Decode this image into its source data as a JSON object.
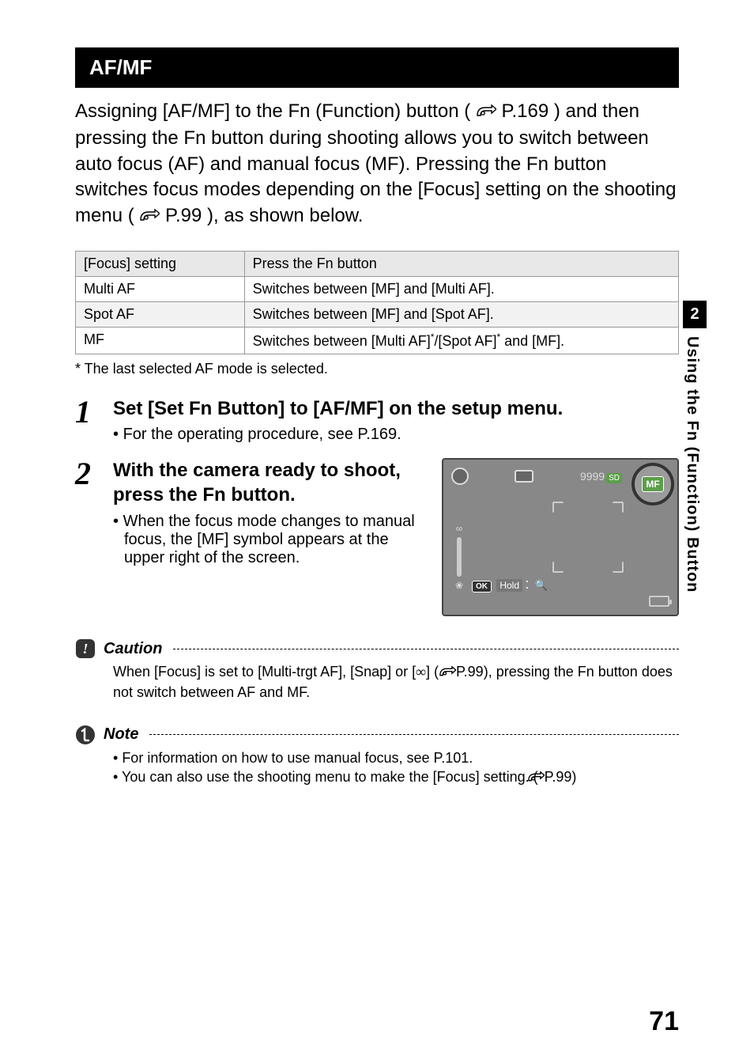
{
  "title_bar": "AF/MF",
  "intro": {
    "part1": "Assigning [AF/MF] to the Fn (Function) button (",
    "ref1": "P.169",
    "part2": ") and then pressing the Fn button during shooting allows you to switch between auto focus (AF) and manual focus (MF). Pressing the Fn button switches focus modes depending on the [Focus] setting on the shooting menu (",
    "ref2": "P.99",
    "part3": "), as shown below."
  },
  "table": {
    "h1": "[Focus] setting",
    "h2": "Press the Fn button",
    "rows": [
      {
        "c1": "Multi AF",
        "c2": "Switches between [MF] and [Multi AF]."
      },
      {
        "c1": "Spot AF",
        "c2": "Switches between [MF] and [Spot AF]."
      },
      {
        "c1": "MF",
        "c2_a": "Switches between [Multi AF]",
        "c2_b": "/[Spot AF]",
        "c2_c": " and [MF]."
      }
    ]
  },
  "footnote": "*    The last selected AF mode is selected.",
  "steps": {
    "s1_num": "1",
    "s1_title": "Set [Set Fn Button] to [AF/MF] on the setup menu.",
    "s1_sub": "For the operating procedure, see P.169.",
    "s2_num": "2",
    "s2_title": "With the camera ready to shoot, press the Fn button.",
    "s2_sub": "When the focus mode changes to manual focus, the [MF] symbol appears at the upper right of the screen."
  },
  "screen": {
    "mf_label": "MF",
    "count": "9999",
    "sd": "SD",
    "ok": "OK",
    "hold": "Hold",
    "colon": ":"
  },
  "caution": {
    "title": "Caution",
    "body_a": "When [Focus] is set to [Multi-trgt AF], [Snap] or [",
    "inf": "∞",
    "body_b": "] (",
    "ref": "P.99",
    "body_c": "), pressing the Fn button does not switch between AF and MF."
  },
  "note": {
    "title": "Note",
    "b1": "For information on how to use manual focus, see P.101.",
    "b2_a": "You can also use the shooting menu to make the [Focus] setting. (",
    "b2_ref": "P.99",
    "b2_b": ")"
  },
  "side": {
    "num": "2",
    "text": "Using the Fn (Function) Button"
  },
  "page_number": "71"
}
